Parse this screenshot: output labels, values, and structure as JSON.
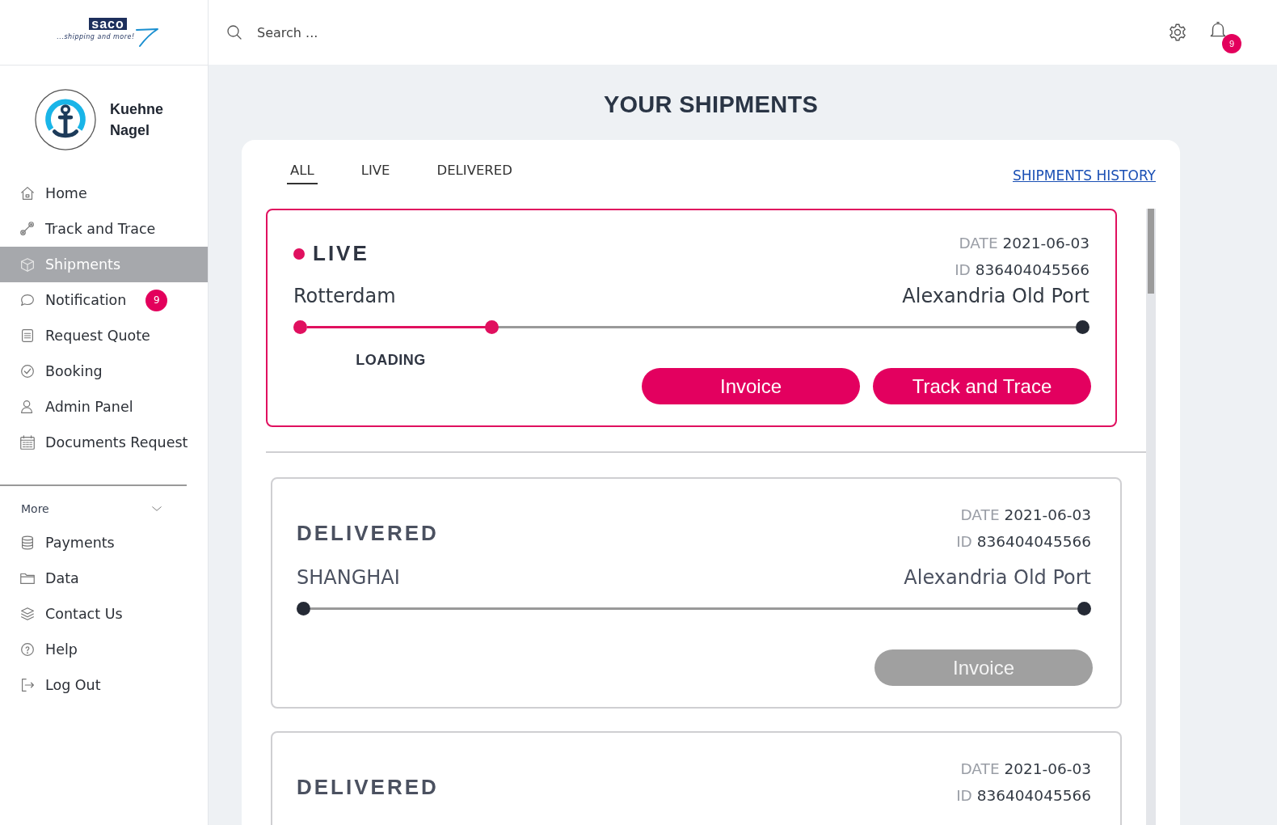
{
  "logo": {
    "wordmark": "saco",
    "tagline": "...shipping and more!"
  },
  "account": {
    "name": "Kuehne Nagel"
  },
  "sidebar": {
    "items": [
      {
        "label": "Home",
        "selected": false
      },
      {
        "label": "Track and Trace",
        "selected": false
      },
      {
        "label": "Shipments",
        "selected": true
      },
      {
        "label": "Notification",
        "selected": false,
        "badge": "9"
      },
      {
        "label": "Request Quote",
        "selected": false
      },
      {
        "label": "Booking",
        "selected": false
      },
      {
        "label": "Admin Panel",
        "selected": false
      },
      {
        "label": "Documents Request",
        "selected": false
      }
    ],
    "more": {
      "label": "More",
      "expanded": true,
      "items": [
        {
          "label": "Payments",
          "selected": false
        },
        {
          "label": "Data",
          "selected": false
        },
        {
          "label": "Contact Us",
          "selected": false
        },
        {
          "label": "Help",
          "selected": false
        },
        {
          "label": "Log Out",
          "selected": false
        }
      ]
    }
  },
  "header": {
    "search": {
      "placeholder": "Search ..."
    },
    "notifications_badge": "9"
  },
  "page_title": "YOUR SHIPMENTS",
  "tabs": [
    {
      "label": "ALL",
      "selected": true
    },
    {
      "label": "LIVE",
      "selected": false
    },
    {
      "label": "DELIVERED",
      "selected": false
    }
  ],
  "history_link": "SHIPMENTS HISTORY",
  "shipments": [
    {
      "kind": "live",
      "status": "LIVE",
      "date_label": "DATE",
      "date": "2021-06-03",
      "id_label": "ID",
      "id": "836404045566",
      "origin": "Rotterdam",
      "destination": "Alexandria Old Port",
      "level": 0.24,
      "stage": "LOADING",
      "buttons": [
        {
          "label": "Invoice",
          "disabled": false
        },
        {
          "label": "Track and Trace",
          "disabled": false
        }
      ]
    },
    {
      "kind": "delivered",
      "status": "DELIVERED",
      "date_label": "DATE",
      "date": "2021-06-03",
      "id_label": "ID",
      "id": "836404045566",
      "origin": "SHANGHAI",
      "destination": "Alexandria Old Port",
      "buttons": [
        {
          "label": "Invoice",
          "disabled": true
        }
      ]
    },
    {
      "kind": "delivered",
      "status": "DELIVERED",
      "date_label": "DATE",
      "date": "2021-06-03",
      "id_label": "ID",
      "id": "836404045566"
    }
  ]
}
